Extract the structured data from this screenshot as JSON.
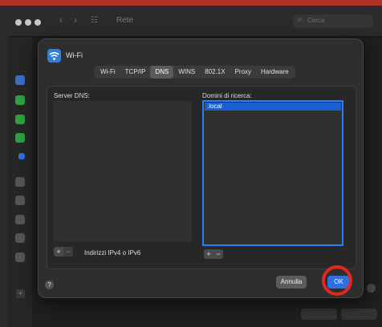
{
  "window": {
    "title": "Rete",
    "search_placeholder": "Cerca"
  },
  "sheet": {
    "title": "Wi-Fi",
    "tabs": [
      {
        "label": "Wi-Fi",
        "active": false
      },
      {
        "label": "TCP/IP",
        "active": false
      },
      {
        "label": "DNS",
        "active": true
      },
      {
        "label": "WINS",
        "active": false
      },
      {
        "label": "802.1X",
        "active": false
      },
      {
        "label": "Proxy",
        "active": false
      },
      {
        "label": "Hardware",
        "active": false
      }
    ],
    "dns": {
      "servers_label": "Server DNS:",
      "servers_hint": "Indirizzi IPv4 o IPv6",
      "search_domains_label": "Domini di ricerca:",
      "search_domains": [
        ".local"
      ]
    },
    "buttons": {
      "cancel": "Annulla",
      "ok": "OK"
    }
  },
  "icons": {
    "wifi": "wifi-icon",
    "search": "search-icon",
    "help": "help-icon",
    "add": "plus-icon",
    "remove": "minus-icon"
  },
  "colors": {
    "accent": "#2f6fe0",
    "highlight_ring": "#e3271c",
    "sidebar_green": "#2ea043",
    "wifi_blue": "#2f7fe3"
  }
}
